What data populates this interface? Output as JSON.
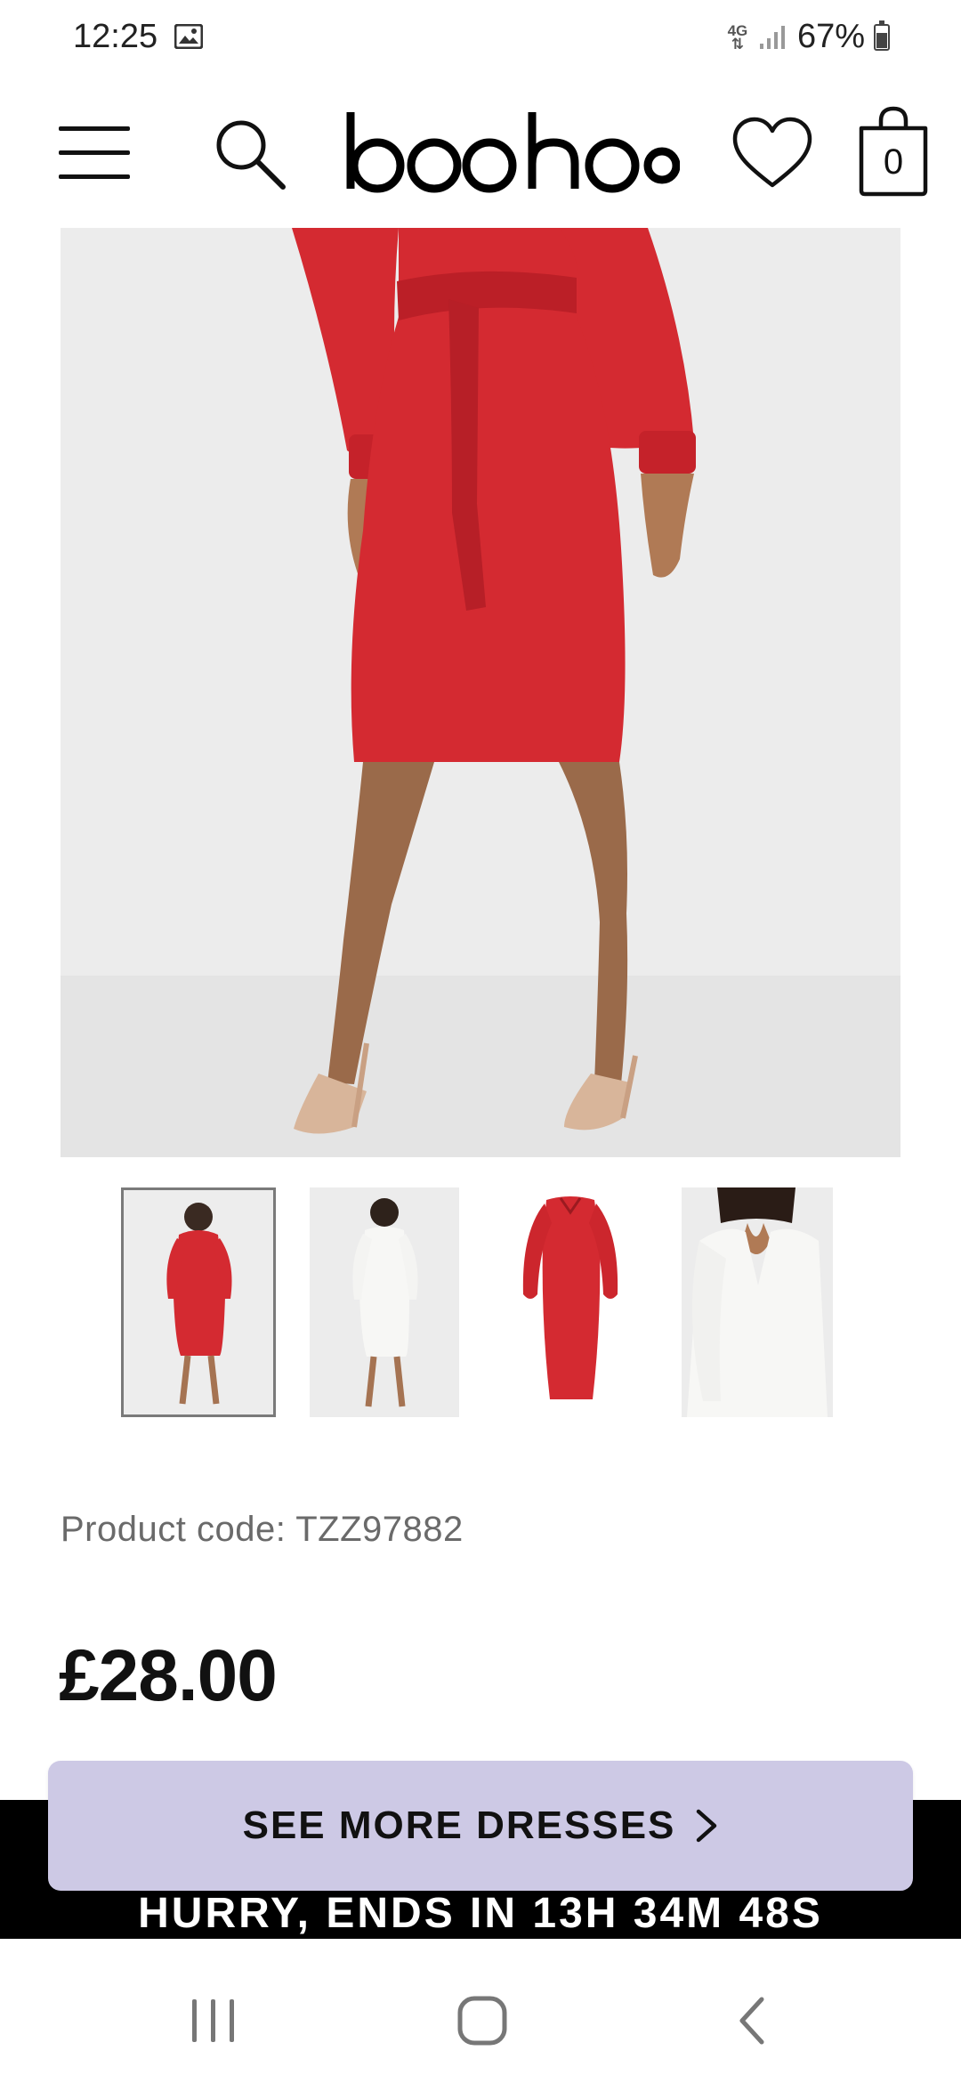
{
  "status_bar": {
    "time": "12:25",
    "network": "4G",
    "battery": "67%"
  },
  "header": {
    "logo": "boohoo",
    "bag_count": "0",
    "icons": [
      "menu-icon",
      "search-icon",
      "heart-icon",
      "bag-icon"
    ]
  },
  "product": {
    "code_label": "Product code: TZZ97882",
    "price": "£28.00",
    "selected_thumbnail": 1,
    "colors": {
      "dress_red": "#d42a31",
      "dress_white": "#f7f7f5",
      "background": "#ececec"
    }
  },
  "promo": {
    "text": "HURRY, ENDS IN 13H 34M 48S"
  },
  "cta": {
    "label": "SEE MORE DRESSES",
    "color": "#cdc9e5"
  },
  "nav": {
    "icons": [
      "recent-apps-icon",
      "home-icon",
      "back-icon"
    ]
  }
}
